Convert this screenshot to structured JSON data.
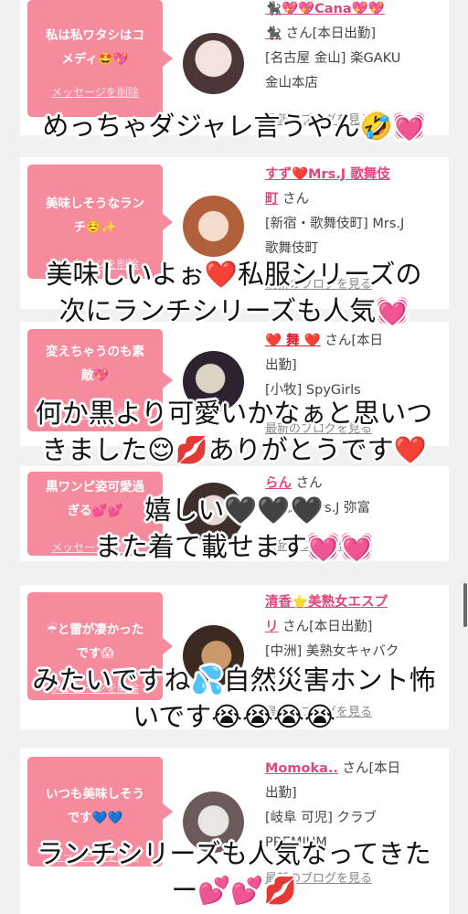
{
  "cards": [
    {
      "bubble": [
        "私は私ワタシはコ",
        "メディ🤩💖"
      ],
      "delete_label": "メッセージを削除",
      "name": "🐈‍⬛💖💖Cana💖💖",
      "name_cont": "🐈‍⬛",
      "san": "さん[本日出勤]",
      "shop_lines": [
        "[名古屋 金山] 楽GAKU",
        "金山本店"
      ],
      "blog_label": "最新のブログを見る",
      "avatar_colors": [
        "#f1e2dd",
        "#4a3636"
      ]
    },
    {
      "bubble": [
        "美味しそうなラン",
        "チ☺️✨"
      ],
      "delete_label": "メッセージを削除",
      "name": "すず❤️Mrs.J 歌舞伎",
      "name_cont": "町",
      "san": "さん",
      "shop_lines": [
        "[新宿・歌舞伎町] Mrs.J",
        "歌舞伎町"
      ],
      "blog_label": "最新のブログを見る",
      "avatar_colors": [
        "#f3dccd",
        "#b0603a"
      ]
    },
    {
      "bubble": [
        "変えちゃうのも素",
        "敵💖"
      ],
      "delete_label": "メッセージを削除",
      "name": "❤️ 舞 ❤️",
      "san": "さん[本日",
      "san_cont": "出勤]",
      "shop_lines": [
        "[小牧] SpyGirls"
      ],
      "blog_label": "最新のブログを見る",
      "avatar_colors": [
        "#ded4c6",
        "#2c2230"
      ]
    },
    {
      "bubble": [
        "黒ワンピ姿可愛過",
        "ぎる💕💕"
      ],
      "delete_label": "メッセージを削除",
      "name": "らん",
      "san": "さん",
      "shop_lines": [
        "[豊橋] mrs.J 弥富"
      ],
      "blog_label": "最新のブログを見る",
      "avatar_colors": [
        "#e7d8d3",
        "#3e2e2c"
      ]
    },
    {
      "bubble": [
        "☔と雷が凄かった",
        "です😱"
      ],
      "delete_label": "メッセージを削除",
      "name": "清香⭐美熟女エスプ",
      "name_cont": "リ",
      "san": "さん[本日出勤]",
      "shop_lines": [
        "[中洲] 美熟女キャバク",
        "ラ"
      ],
      "blog_label": "最新のブログを見る",
      "avatar_colors": [
        "#c99a6b",
        "#3a2a20"
      ]
    },
    {
      "bubble": [
        "いつも美味しそう",
        "です💙💙"
      ],
      "delete_label": "メッセージを削除",
      "name": "Momoka..",
      "san": "さん[本日",
      "san_cont": "出勤]",
      "shop_lines": [
        "[岐阜 可児] クラブ",
        "PREMIUM"
      ],
      "blog_label": "最新のブログを見る",
      "avatar_colors": [
        "#e9e5e2",
        "#6a5b5a"
      ]
    }
  ],
  "captions": [
    [
      "めっちゃダジャレ言うやん🤣💓"
    ],
    [
      "美味しいよぉ❤️私服シリーズの",
      "次にランチシリーズも人気💓"
    ],
    [
      "何か黒より可愛いかなぁと思いつ",
      "きました😌💋ありがとうです❤️"
    ],
    [
      "嬉しい🖤🖤🖤",
      "また着て載せます💓💓"
    ],
    [
      "みたいですね💦自然災害ホント怖",
      "いです😭😭😭😭"
    ],
    [
      "ランチシリーズも人気なってきた",
      "ー💕💕💋"
    ]
  ],
  "colors": {
    "bubble": "#f68b9d",
    "name": "#e0467e",
    "background": "#f1f1f1"
  }
}
